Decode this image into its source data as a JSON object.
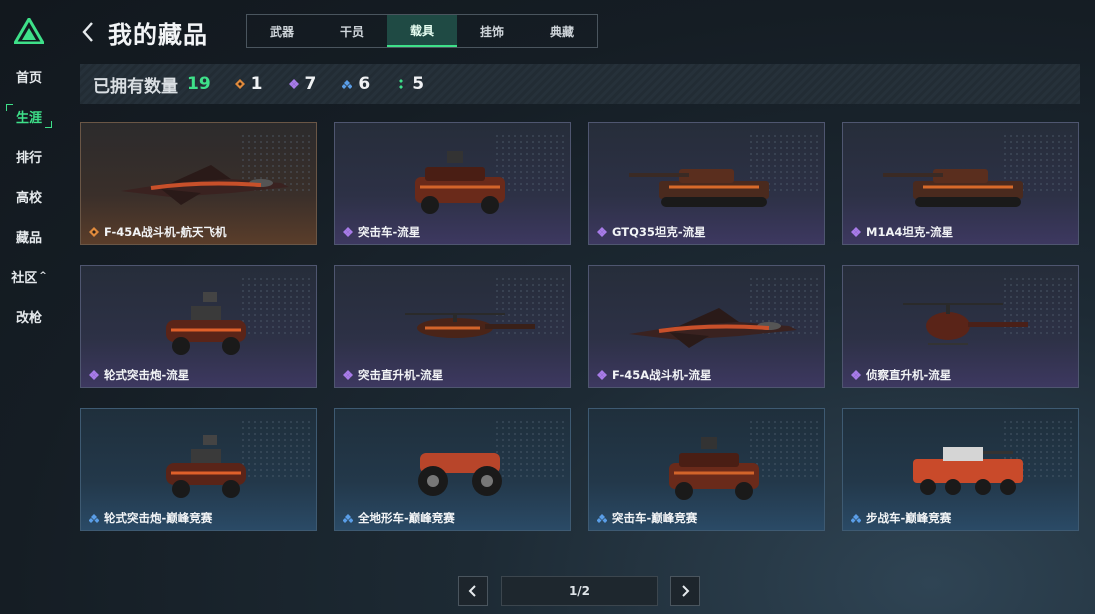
{
  "sidebar": {
    "items": [
      {
        "label": "首页"
      },
      {
        "label": "生涯",
        "active": true
      },
      {
        "label": "排行"
      },
      {
        "label": "高校"
      },
      {
        "label": "藏品"
      },
      {
        "label": "社区",
        "caret": "^"
      },
      {
        "label": "改枪"
      }
    ]
  },
  "header": {
    "title": "我的藏品",
    "tabs": [
      {
        "label": "武器"
      },
      {
        "label": "干员"
      },
      {
        "label": "载具",
        "active": true
      },
      {
        "label": "挂饰"
      },
      {
        "label": "典藏"
      }
    ]
  },
  "stats": {
    "owned_label": "已拥有数量",
    "total": "19",
    "counts": [
      {
        "rarity": "orange",
        "value": "1"
      },
      {
        "rarity": "purple",
        "value": "7"
      },
      {
        "rarity": "blue",
        "value": "6"
      },
      {
        "rarity": "green",
        "value": "5"
      }
    ]
  },
  "colors": {
    "accent": "#3ee089",
    "orange": "#e08a3c",
    "purple": "#a77be8",
    "blue": "#5a9ee8",
    "green": "#3ee089"
  },
  "items": [
    {
      "name": "F-45A战斗机-航天飞机",
      "rarity": "orange",
      "icon": "jet-icon"
    },
    {
      "name": "突击车-流星",
      "rarity": "purple",
      "icon": "assault-vehicle-icon"
    },
    {
      "name": "GTQ35坦克-流星",
      "rarity": "purple",
      "icon": "tank-icon"
    },
    {
      "name": "M1A4坦克-流星",
      "rarity": "purple",
      "icon": "tank-icon"
    },
    {
      "name": "轮式突击炮-流星",
      "rarity": "purple",
      "icon": "wheeled-gun-icon"
    },
    {
      "name": "突击直升机-流星",
      "rarity": "purple",
      "icon": "attack-helicopter-icon"
    },
    {
      "name": "F-45A战斗机-流星",
      "rarity": "purple",
      "icon": "jet-icon"
    },
    {
      "name": "侦察直升机-流星",
      "rarity": "purple",
      "icon": "scout-helicopter-icon"
    },
    {
      "name": "轮式突击炮-巅峰竞赛",
      "rarity": "blue",
      "icon": "wheeled-gun-icon"
    },
    {
      "name": "全地形车-巅峰竞赛",
      "rarity": "blue",
      "icon": "atv-icon"
    },
    {
      "name": "突击车-巅峰竞赛",
      "rarity": "blue",
      "icon": "assault-vehicle-icon"
    },
    {
      "name": "步战车-巅峰竞赛",
      "rarity": "blue",
      "icon": "ifv-icon"
    }
  ],
  "pagination": {
    "display": "1/2"
  }
}
